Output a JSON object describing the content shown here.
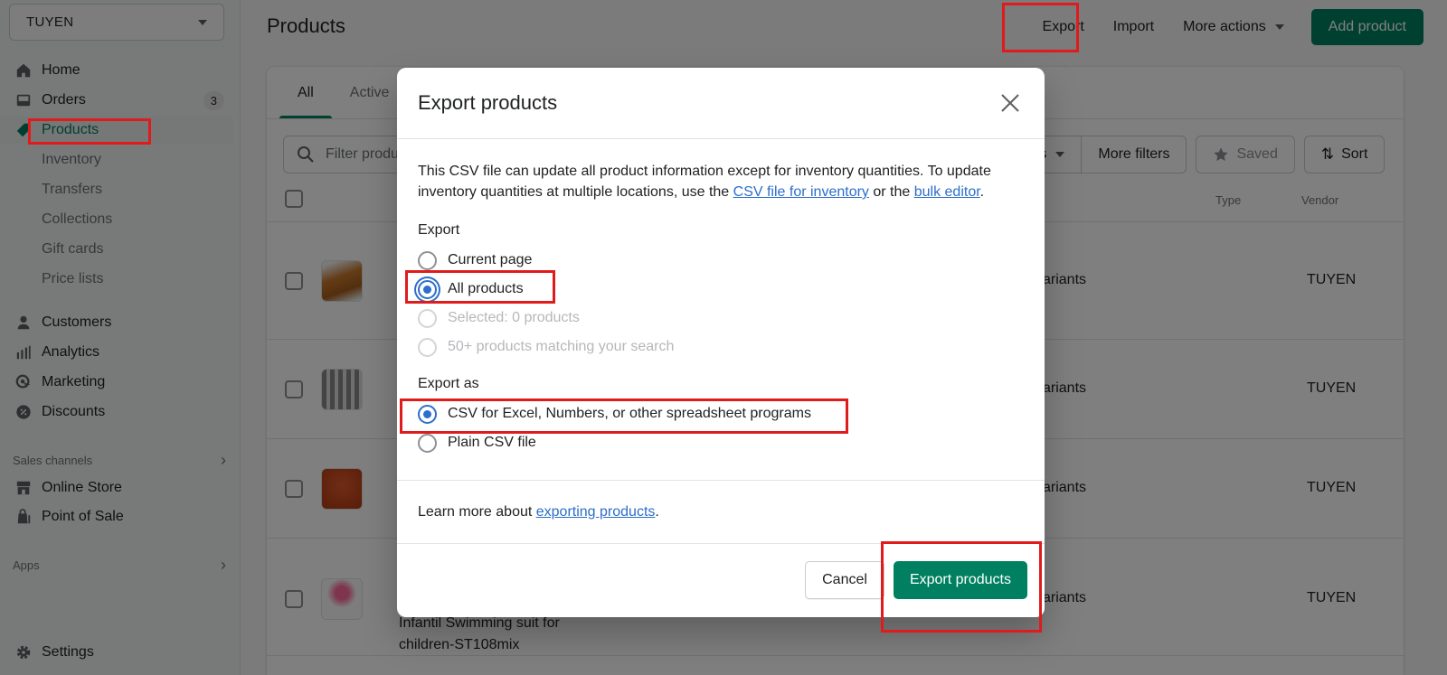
{
  "sidebar": {
    "store_name": "TUYEN",
    "items": [
      {
        "label": "Home",
        "icon": "home-icon"
      },
      {
        "label": "Orders",
        "icon": "orders-icon",
        "badge": "3"
      },
      {
        "label": "Products",
        "icon": "tag-icon",
        "active": true
      },
      {
        "label": "Inventory",
        "sub": true
      },
      {
        "label": "Transfers",
        "sub": true
      },
      {
        "label": "Collections",
        "sub": true
      },
      {
        "label": "Gift cards",
        "sub": true
      },
      {
        "label": "Price lists",
        "sub": true
      },
      {
        "label": "Customers",
        "icon": "person-icon"
      },
      {
        "label": "Analytics",
        "icon": "bar-chart-icon"
      },
      {
        "label": "Marketing",
        "icon": "target-icon"
      },
      {
        "label": "Discounts",
        "icon": "discount-icon"
      }
    ],
    "sales_channels_label": "Sales channels",
    "channels": [
      {
        "label": "Online Store",
        "icon": "store-icon"
      },
      {
        "label": "Point of Sale",
        "icon": "pos-bag-icon"
      }
    ],
    "apps_label": "Apps",
    "settings_label": "Settings"
  },
  "header": {
    "title": "Products",
    "export_label": "Export",
    "import_label": "Import",
    "more_actions_label": "More actions",
    "add_product_label": "Add product"
  },
  "tabs": [
    {
      "label": "All",
      "active": true
    },
    {
      "label": "Active"
    }
  ],
  "filters": {
    "search_placeholder": "Filter products",
    "status_label": "Status",
    "more_filters_label": "More filters",
    "saved_label": "Saved",
    "sort_label": "Sort"
  },
  "table": {
    "columns": {
      "type": "Type",
      "vendor": "Vendor"
    },
    "rows": [
      {
        "variants": "variants",
        "vendor": "TUYEN",
        "name": ""
      },
      {
        "variants": "variants",
        "vendor": "TUYEN",
        "name": ""
      },
      {
        "variants": "variants",
        "vendor": "TUYEN",
        "name": ""
      },
      {
        "variants": "variants",
        "vendor": "TUYEN",
        "name_line1": "Infantil Swimming suit for",
        "name_line2": "children-ST108mix"
      }
    ]
  },
  "modal": {
    "title": "Export products",
    "description_prefix": "This CSV file can update all product information except for inventory quantities. To update inventory quantities at multiple locations, use the ",
    "link_csv_inventory": "CSV file for inventory",
    "description_middle": " or the ",
    "link_bulk_editor": "bulk editor",
    "description_suffix": ".",
    "export_label": "Export",
    "export_options": [
      {
        "label": "Current page",
        "checked": false,
        "disabled": false
      },
      {
        "label": "All products",
        "checked": true,
        "disabled": false
      },
      {
        "label": "Selected: 0 products",
        "checked": false,
        "disabled": true
      },
      {
        "label": "50+ products matching your search",
        "checked": false,
        "disabled": true
      }
    ],
    "export_as_label": "Export as",
    "format_options": [
      {
        "label": "CSV for Excel, Numbers, or other spreadsheet programs",
        "checked": true
      },
      {
        "label": "Plain CSV file",
        "checked": false
      }
    ],
    "learn_prefix": "Learn more about ",
    "learn_link": "exporting products",
    "learn_suffix": ".",
    "cancel_label": "Cancel",
    "submit_label": "Export products"
  },
  "colors": {
    "primary": "#008060",
    "link": "#2c6ecb",
    "highlight": "#e01b1b"
  }
}
